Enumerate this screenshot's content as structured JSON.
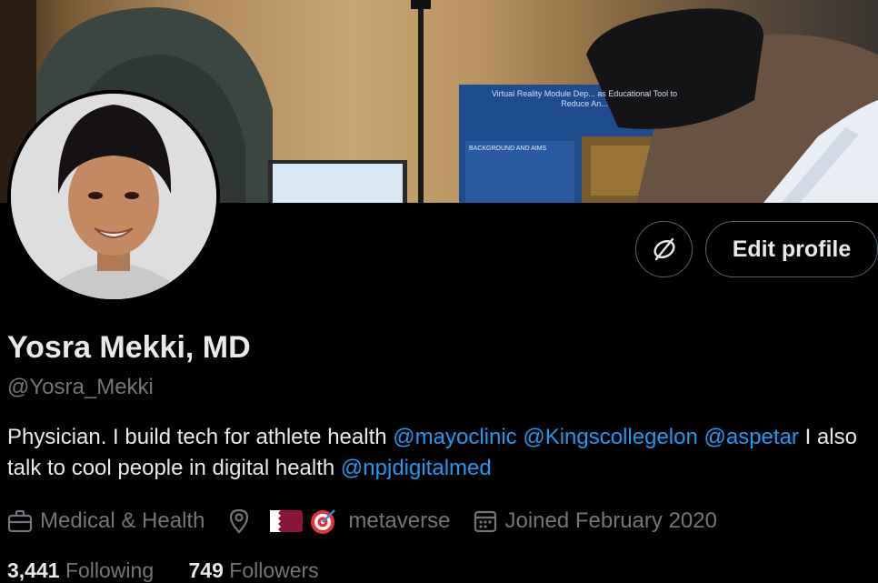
{
  "profile": {
    "name": "Yosra Mekki, MD",
    "handle": "@Yosra_Mekki",
    "bio": {
      "text1": "Physician. I build tech for athlete health ",
      "mention1": "@mayoclinic",
      "mention2": "@Kingscollegelon",
      "mention3": "@aspetar",
      "text2": " I also talk to cool people in digital health ",
      "mention4": "@npjdigitalmed"
    },
    "category": "Medical & Health",
    "location": "metaverse",
    "joined": "Joined February 2020",
    "following_count": "3,441",
    "following_label": "Following",
    "followers_count": "749",
    "followers_label": "Followers"
  },
  "actions": {
    "edit_profile": "Edit profile"
  },
  "banner": {
    "poster_title": "Virtual Reality Module Dep... as Educational Tool to Reduce An...",
    "poster_section": "BACKGROUND AND AIMS"
  },
  "colors": {
    "background": "#000000",
    "text": "#e7e9ea",
    "muted": "#71767b",
    "link": "#1d9bf0",
    "border": "#536471"
  },
  "icons": {
    "developer": "unlink-icon",
    "category": "briefcase-icon",
    "location": "location-pin-icon",
    "joined": "calendar-icon"
  }
}
